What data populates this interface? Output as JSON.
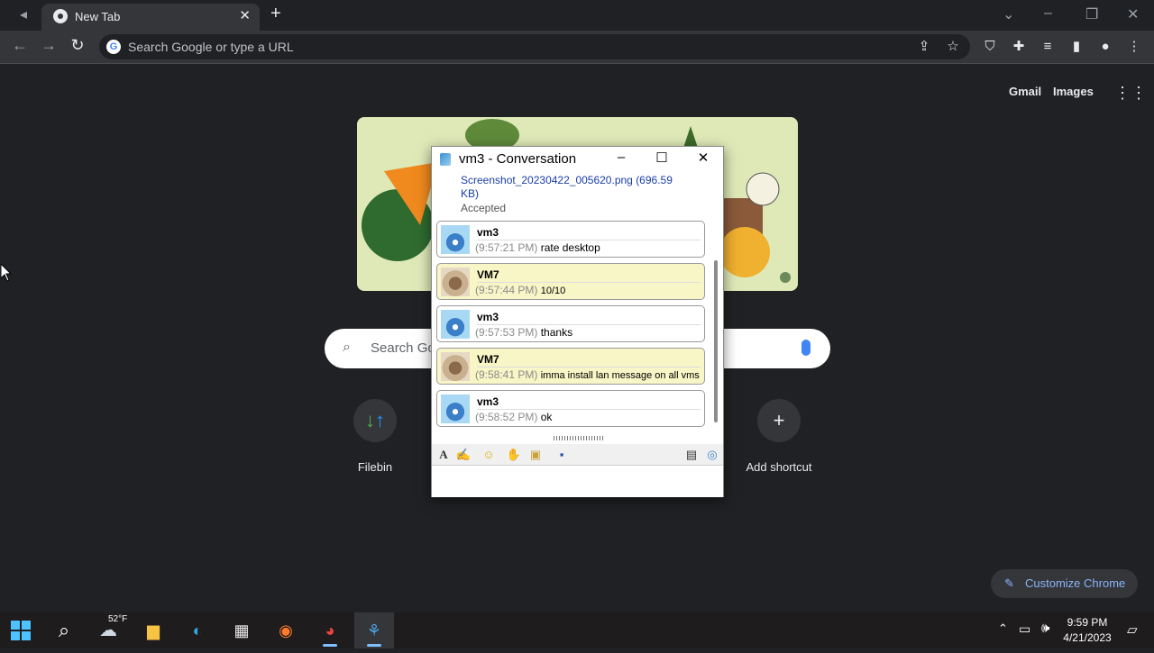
{
  "browser": {
    "tab_title": "New Tab",
    "omnibox_placeholder": "Search Google or type a URL",
    "new_tab_symbol": "+",
    "close_symbol": "✕"
  },
  "ntp": {
    "gmail_label": "Gmail",
    "images_label": "Images",
    "search_placeholder": "Search Go",
    "shortcuts": [
      {
        "label": "Filebin",
        "icon": "arrows-updown-icon"
      },
      {
        "label": "Add shortcut",
        "icon": "plus-icon"
      }
    ],
    "customize_label": "Customize Chrome"
  },
  "conversation": {
    "window_title": "vm3 - Conversation",
    "file_transfer": {
      "file_name": "Screenshot_20230422_005620.png",
      "file_size": "(696.59 KB)",
      "status": "Accepted"
    },
    "messages": [
      {
        "sender": "vm3",
        "time": "(9:57:21 PM)",
        "text": "rate desktop"
      },
      {
        "sender": "VM7",
        "time": "(9:57:44 PM)",
        "text": "10/10"
      },
      {
        "sender": "vm3",
        "time": "(9:57:53 PM)",
        "text": "thanks"
      },
      {
        "sender": "VM7",
        "time": "(9:58:41 PM)",
        "text": "imma install lan message on all vms"
      },
      {
        "sender": "vm3",
        "time": "(9:58:52 PM)",
        "text": "ok"
      }
    ],
    "input_value": ""
  },
  "taskbar": {
    "weather": "52°F",
    "time": "9:59 PM",
    "date": "4/21/2023"
  },
  "colors": {
    "chrome_bg": "#202124",
    "toolbar_bg": "#35363a",
    "link_blue": "#8ab4f8",
    "bubble_other": "#f8f5c6"
  }
}
